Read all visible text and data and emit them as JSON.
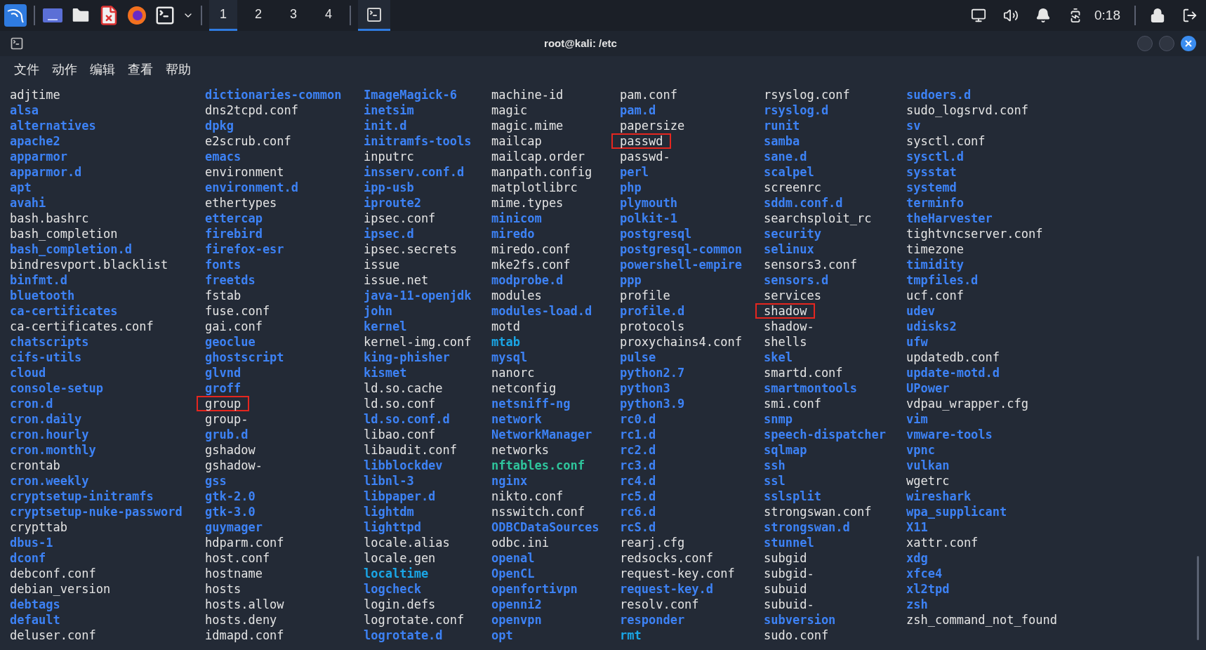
{
  "taskbar": {
    "workspaces": [
      {
        "label": "1",
        "selected": true
      },
      {
        "label": "2",
        "selected": false
      },
      {
        "label": "3",
        "selected": false
      },
      {
        "label": "4",
        "selected": false
      }
    ],
    "window_task": {
      "selected": true
    },
    "clock": "0:18"
  },
  "window": {
    "title": "root@kali: /etc"
  },
  "menu": [
    "文件",
    "动作",
    "编辑",
    "查看",
    "帮助"
  ],
  "listing": {
    "columns": [
      [
        {
          "name": "adjtime",
          "kind": "file",
          "highlighted": false
        },
        {
          "name": "alsa",
          "kind": "dir",
          "highlighted": false
        },
        {
          "name": "alternatives",
          "kind": "dir",
          "highlighted": false
        },
        {
          "name": "apache2",
          "kind": "dir",
          "highlighted": false
        },
        {
          "name": "apparmor",
          "kind": "dir",
          "highlighted": false
        },
        {
          "name": "apparmor.d",
          "kind": "dir",
          "highlighted": false
        },
        {
          "name": "apt",
          "kind": "dir",
          "highlighted": false
        },
        {
          "name": "avahi",
          "kind": "dir",
          "highlighted": false
        },
        {
          "name": "bash.bashrc",
          "kind": "file",
          "highlighted": false
        },
        {
          "name": "bash_completion",
          "kind": "file",
          "highlighted": false
        },
        {
          "name": "bash_completion.d",
          "kind": "dir",
          "highlighted": false
        },
        {
          "name": "bindresvport.blacklist",
          "kind": "file",
          "highlighted": false
        },
        {
          "name": "binfmt.d",
          "kind": "dir",
          "highlighted": false
        },
        {
          "name": "bluetooth",
          "kind": "dir",
          "highlighted": false
        },
        {
          "name": "ca-certificates",
          "kind": "dir",
          "highlighted": false
        },
        {
          "name": "ca-certificates.conf",
          "kind": "file",
          "highlighted": false
        },
        {
          "name": "chatscripts",
          "kind": "dir",
          "highlighted": false
        },
        {
          "name": "cifs-utils",
          "kind": "dir",
          "highlighted": false
        },
        {
          "name": "cloud",
          "kind": "dir",
          "highlighted": false
        },
        {
          "name": "console-setup",
          "kind": "dir",
          "highlighted": false
        },
        {
          "name": "cron.d",
          "kind": "dir",
          "highlighted": false
        },
        {
          "name": "cron.daily",
          "kind": "dir",
          "highlighted": false
        },
        {
          "name": "cron.hourly",
          "kind": "dir",
          "highlighted": false
        },
        {
          "name": "cron.monthly",
          "kind": "dir",
          "highlighted": false
        },
        {
          "name": "crontab",
          "kind": "file",
          "highlighted": false
        },
        {
          "name": "cron.weekly",
          "kind": "dir",
          "highlighted": false
        },
        {
          "name": "cryptsetup-initramfs",
          "kind": "dir",
          "highlighted": false
        },
        {
          "name": "cryptsetup-nuke-password",
          "kind": "dir",
          "highlighted": false
        },
        {
          "name": "crypttab",
          "kind": "file",
          "highlighted": false
        },
        {
          "name": "dbus-1",
          "kind": "dir",
          "highlighted": false
        },
        {
          "name": "dconf",
          "kind": "dir",
          "highlighted": false
        },
        {
          "name": "debconf.conf",
          "kind": "file",
          "highlighted": false
        },
        {
          "name": "debian_version",
          "kind": "file",
          "highlighted": false
        },
        {
          "name": "debtags",
          "kind": "dir",
          "highlighted": false
        },
        {
          "name": "default",
          "kind": "dir",
          "highlighted": false
        },
        {
          "name": "deluser.conf",
          "kind": "file",
          "highlighted": false
        }
      ],
      [
        {
          "name": "dictionaries-common",
          "kind": "dir",
          "highlighted": false
        },
        {
          "name": "dns2tcpd.conf",
          "kind": "file",
          "highlighted": false
        },
        {
          "name": "dpkg",
          "kind": "dir",
          "highlighted": false
        },
        {
          "name": "e2scrub.conf",
          "kind": "file",
          "highlighted": false
        },
        {
          "name": "emacs",
          "kind": "dir",
          "highlighted": false
        },
        {
          "name": "environment",
          "kind": "file",
          "highlighted": false
        },
        {
          "name": "environment.d",
          "kind": "dir",
          "highlighted": false
        },
        {
          "name": "ethertypes",
          "kind": "file",
          "highlighted": false
        },
        {
          "name": "ettercap",
          "kind": "dir",
          "highlighted": false
        },
        {
          "name": "firebird",
          "kind": "dir",
          "highlighted": false
        },
        {
          "name": "firefox-esr",
          "kind": "dir",
          "highlighted": false
        },
        {
          "name": "fonts",
          "kind": "dir",
          "highlighted": false
        },
        {
          "name": "freetds",
          "kind": "dir",
          "highlighted": false
        },
        {
          "name": "fstab",
          "kind": "file",
          "highlighted": false
        },
        {
          "name": "fuse.conf",
          "kind": "file",
          "highlighted": false
        },
        {
          "name": "gai.conf",
          "kind": "file",
          "highlighted": false
        },
        {
          "name": "geoclue",
          "kind": "dir",
          "highlighted": false
        },
        {
          "name": "ghostscript",
          "kind": "dir",
          "highlighted": false
        },
        {
          "name": "glvnd",
          "kind": "dir",
          "highlighted": false
        },
        {
          "name": "groff",
          "kind": "dir",
          "highlighted": false
        },
        {
          "name": "group",
          "kind": "file",
          "highlighted": true
        },
        {
          "name": "group-",
          "kind": "file",
          "highlighted": false
        },
        {
          "name": "grub.d",
          "kind": "dir",
          "highlighted": false
        },
        {
          "name": "gshadow",
          "kind": "file",
          "highlighted": false
        },
        {
          "name": "gshadow-",
          "kind": "file",
          "highlighted": false
        },
        {
          "name": "gss",
          "kind": "dir",
          "highlighted": false
        },
        {
          "name": "gtk-2.0",
          "kind": "dir",
          "highlighted": false
        },
        {
          "name": "gtk-3.0",
          "kind": "dir",
          "highlighted": false
        },
        {
          "name": "guymager",
          "kind": "dir",
          "highlighted": false
        },
        {
          "name": "hdparm.conf",
          "kind": "file",
          "highlighted": false
        },
        {
          "name": "host.conf",
          "kind": "file",
          "highlighted": false
        },
        {
          "name": "hostname",
          "kind": "file",
          "highlighted": false
        },
        {
          "name": "hosts",
          "kind": "file",
          "highlighted": false
        },
        {
          "name": "hosts.allow",
          "kind": "file",
          "highlighted": false
        },
        {
          "name": "hosts.deny",
          "kind": "file",
          "highlighted": false
        },
        {
          "name": "idmapd.conf",
          "kind": "file",
          "highlighted": false
        }
      ],
      [
        {
          "name": "ImageMagick-6",
          "kind": "dir",
          "highlighted": false
        },
        {
          "name": "inetsim",
          "kind": "dir",
          "highlighted": false
        },
        {
          "name": "init.d",
          "kind": "dir",
          "highlighted": false
        },
        {
          "name": "initramfs-tools",
          "kind": "dir",
          "highlighted": false
        },
        {
          "name": "inputrc",
          "kind": "file",
          "highlighted": false
        },
        {
          "name": "insserv.conf.d",
          "kind": "dir",
          "highlighted": false
        },
        {
          "name": "ipp-usb",
          "kind": "dir",
          "highlighted": false
        },
        {
          "name": "iproute2",
          "kind": "dir",
          "highlighted": false
        },
        {
          "name": "ipsec.conf",
          "kind": "file",
          "highlighted": false
        },
        {
          "name": "ipsec.d",
          "kind": "dir",
          "highlighted": false
        },
        {
          "name": "ipsec.secrets",
          "kind": "file",
          "highlighted": false
        },
        {
          "name": "issue",
          "kind": "file",
          "highlighted": false
        },
        {
          "name": "issue.net",
          "kind": "file",
          "highlighted": false
        },
        {
          "name": "java-11-openjdk",
          "kind": "dir",
          "highlighted": false
        },
        {
          "name": "john",
          "kind": "dir",
          "highlighted": false
        },
        {
          "name": "kernel",
          "kind": "dir",
          "highlighted": false
        },
        {
          "name": "kernel-img.conf",
          "kind": "file",
          "highlighted": false
        },
        {
          "name": "king-phisher",
          "kind": "dir",
          "highlighted": false
        },
        {
          "name": "kismet",
          "kind": "dir",
          "highlighted": false
        },
        {
          "name": "ld.so.cache",
          "kind": "file",
          "highlighted": false
        },
        {
          "name": "ld.so.conf",
          "kind": "file",
          "highlighted": false
        },
        {
          "name": "ld.so.conf.d",
          "kind": "dir",
          "highlighted": false
        },
        {
          "name": "libao.conf",
          "kind": "file",
          "highlighted": false
        },
        {
          "name": "libaudit.conf",
          "kind": "file",
          "highlighted": false
        },
        {
          "name": "libblockdev",
          "kind": "dir",
          "highlighted": false
        },
        {
          "name": "libnl-3",
          "kind": "dir",
          "highlighted": false
        },
        {
          "name": "libpaper.d",
          "kind": "dir",
          "highlighted": false
        },
        {
          "name": "lightdm",
          "kind": "dir",
          "highlighted": false
        },
        {
          "name": "lighttpd",
          "kind": "dir",
          "highlighted": false
        },
        {
          "name": "locale.alias",
          "kind": "file",
          "highlighted": false
        },
        {
          "name": "locale.gen",
          "kind": "file",
          "highlighted": false
        },
        {
          "name": "localtime",
          "kind": "link",
          "highlighted": false
        },
        {
          "name": "logcheck",
          "kind": "dir",
          "highlighted": false
        },
        {
          "name": "login.defs",
          "kind": "file",
          "highlighted": false
        },
        {
          "name": "logrotate.conf",
          "kind": "file",
          "highlighted": false
        },
        {
          "name": "logrotate.d",
          "kind": "dir",
          "highlighted": false
        }
      ],
      [
        {
          "name": "machine-id",
          "kind": "file",
          "highlighted": false
        },
        {
          "name": "magic",
          "kind": "file",
          "highlighted": false
        },
        {
          "name": "magic.mime",
          "kind": "file",
          "highlighted": false
        },
        {
          "name": "mailcap",
          "kind": "file",
          "highlighted": false
        },
        {
          "name": "mailcap.order",
          "kind": "file",
          "highlighted": false
        },
        {
          "name": "manpath.config",
          "kind": "file",
          "highlighted": false
        },
        {
          "name": "matplotlibrc",
          "kind": "file",
          "highlighted": false
        },
        {
          "name": "mime.types",
          "kind": "file",
          "highlighted": false
        },
        {
          "name": "minicom",
          "kind": "dir",
          "highlighted": false
        },
        {
          "name": "miredo",
          "kind": "dir",
          "highlighted": false
        },
        {
          "name": "miredo.conf",
          "kind": "file",
          "highlighted": false
        },
        {
          "name": "mke2fs.conf",
          "kind": "file",
          "highlighted": false
        },
        {
          "name": "modprobe.d",
          "kind": "dir",
          "highlighted": false
        },
        {
          "name": "modules",
          "kind": "file",
          "highlighted": false
        },
        {
          "name": "modules-load.d",
          "kind": "dir",
          "highlighted": false
        },
        {
          "name": "motd",
          "kind": "file",
          "highlighted": false
        },
        {
          "name": "mtab",
          "kind": "link",
          "highlighted": false
        },
        {
          "name": "mysql",
          "kind": "dir",
          "highlighted": false
        },
        {
          "name": "nanorc",
          "kind": "file",
          "highlighted": false
        },
        {
          "name": "netconfig",
          "kind": "file",
          "highlighted": false
        },
        {
          "name": "netsniff-ng",
          "kind": "dir",
          "highlighted": false
        },
        {
          "name": "network",
          "kind": "dir",
          "highlighted": false
        },
        {
          "name": "NetworkManager",
          "kind": "dir",
          "highlighted": false
        },
        {
          "name": "networks",
          "kind": "file",
          "highlighted": false
        },
        {
          "name": "nftables.conf",
          "kind": "exec",
          "highlighted": false
        },
        {
          "name": "nginx",
          "kind": "dir",
          "highlighted": false
        },
        {
          "name": "nikto.conf",
          "kind": "file",
          "highlighted": false
        },
        {
          "name": "nsswitch.conf",
          "kind": "file",
          "highlighted": false
        },
        {
          "name": "ODBCDataSources",
          "kind": "dir",
          "highlighted": false
        },
        {
          "name": "odbc.ini",
          "kind": "file",
          "highlighted": false
        },
        {
          "name": "openal",
          "kind": "dir",
          "highlighted": false
        },
        {
          "name": "OpenCL",
          "kind": "dir",
          "highlighted": false
        },
        {
          "name": "openfortivpn",
          "kind": "dir",
          "highlighted": false
        },
        {
          "name": "openni2",
          "kind": "dir",
          "highlighted": false
        },
        {
          "name": "openvpn",
          "kind": "dir",
          "highlighted": false
        },
        {
          "name": "opt",
          "kind": "dir",
          "highlighted": false
        }
      ],
      [
        {
          "name": "pam.conf",
          "kind": "file",
          "highlighted": false
        },
        {
          "name": "pam.d",
          "kind": "dir",
          "highlighted": false
        },
        {
          "name": "papersize",
          "kind": "file",
          "highlighted": false
        },
        {
          "name": "passwd",
          "kind": "file",
          "highlighted": true
        },
        {
          "name": "passwd-",
          "kind": "file",
          "highlighted": false
        },
        {
          "name": "perl",
          "kind": "dir",
          "highlighted": false
        },
        {
          "name": "php",
          "kind": "dir",
          "highlighted": false
        },
        {
          "name": "plymouth",
          "kind": "dir",
          "highlighted": false
        },
        {
          "name": "polkit-1",
          "kind": "dir",
          "highlighted": false
        },
        {
          "name": "postgresql",
          "kind": "dir",
          "highlighted": false
        },
        {
          "name": "postgresql-common",
          "kind": "dir",
          "highlighted": false
        },
        {
          "name": "powershell-empire",
          "kind": "dir",
          "highlighted": false
        },
        {
          "name": "ppp",
          "kind": "dir",
          "highlighted": false
        },
        {
          "name": "profile",
          "kind": "file",
          "highlighted": false
        },
        {
          "name": "profile.d",
          "kind": "dir",
          "highlighted": false
        },
        {
          "name": "protocols",
          "kind": "file",
          "highlighted": false
        },
        {
          "name": "proxychains4.conf",
          "kind": "file",
          "highlighted": false
        },
        {
          "name": "pulse",
          "kind": "dir",
          "highlighted": false
        },
        {
          "name": "python2.7",
          "kind": "dir",
          "highlighted": false
        },
        {
          "name": "python3",
          "kind": "dir",
          "highlighted": false
        },
        {
          "name": "python3.9",
          "kind": "dir",
          "highlighted": false
        },
        {
          "name": "rc0.d",
          "kind": "dir",
          "highlighted": false
        },
        {
          "name": "rc1.d",
          "kind": "dir",
          "highlighted": false
        },
        {
          "name": "rc2.d",
          "kind": "dir",
          "highlighted": false
        },
        {
          "name": "rc3.d",
          "kind": "dir",
          "highlighted": false
        },
        {
          "name": "rc4.d",
          "kind": "dir",
          "highlighted": false
        },
        {
          "name": "rc5.d",
          "kind": "dir",
          "highlighted": false
        },
        {
          "name": "rc6.d",
          "kind": "dir",
          "highlighted": false
        },
        {
          "name": "rcS.d",
          "kind": "dir",
          "highlighted": false
        },
        {
          "name": "rearj.cfg",
          "kind": "file",
          "highlighted": false
        },
        {
          "name": "redsocks.conf",
          "kind": "file",
          "highlighted": false
        },
        {
          "name": "request-key.conf",
          "kind": "file",
          "highlighted": false
        },
        {
          "name": "request-key.d",
          "kind": "dir",
          "highlighted": false
        },
        {
          "name": "resolv.conf",
          "kind": "file",
          "highlighted": false
        },
        {
          "name": "responder",
          "kind": "dir",
          "highlighted": false
        },
        {
          "name": "rmt",
          "kind": "link",
          "highlighted": false
        }
      ],
      [
        {
          "name": "rsyslog.conf",
          "kind": "file",
          "highlighted": false
        },
        {
          "name": "rsyslog.d",
          "kind": "dir",
          "highlighted": false
        },
        {
          "name": "runit",
          "kind": "dir",
          "highlighted": false
        },
        {
          "name": "samba",
          "kind": "dir",
          "highlighted": false
        },
        {
          "name": "sane.d",
          "kind": "dir",
          "highlighted": false
        },
        {
          "name": "scalpel",
          "kind": "dir",
          "highlighted": false
        },
        {
          "name": "screenrc",
          "kind": "file",
          "highlighted": false
        },
        {
          "name": "sddm.conf.d",
          "kind": "dir",
          "highlighted": false
        },
        {
          "name": "searchsploit_rc",
          "kind": "file",
          "highlighted": false
        },
        {
          "name": "security",
          "kind": "dir",
          "highlighted": false
        },
        {
          "name": "selinux",
          "kind": "dir",
          "highlighted": false
        },
        {
          "name": "sensors3.conf",
          "kind": "file",
          "highlighted": false
        },
        {
          "name": "sensors.d",
          "kind": "dir",
          "highlighted": false
        },
        {
          "name": "services",
          "kind": "file",
          "highlighted": false
        },
        {
          "name": "shadow",
          "kind": "file",
          "highlighted": true
        },
        {
          "name": "shadow-",
          "kind": "file",
          "highlighted": false
        },
        {
          "name": "shells",
          "kind": "file",
          "highlighted": false
        },
        {
          "name": "skel",
          "kind": "dir",
          "highlighted": false
        },
        {
          "name": "smartd.conf",
          "kind": "file",
          "highlighted": false
        },
        {
          "name": "smartmontools",
          "kind": "dir",
          "highlighted": false
        },
        {
          "name": "smi.conf",
          "kind": "file",
          "highlighted": false
        },
        {
          "name": "snmp",
          "kind": "dir",
          "highlighted": false
        },
        {
          "name": "speech-dispatcher",
          "kind": "dir",
          "highlighted": false
        },
        {
          "name": "sqlmap",
          "kind": "dir",
          "highlighted": false
        },
        {
          "name": "ssh",
          "kind": "dir",
          "highlighted": false
        },
        {
          "name": "ssl",
          "kind": "dir",
          "highlighted": false
        },
        {
          "name": "sslsplit",
          "kind": "dir",
          "highlighted": false
        },
        {
          "name": "strongswan.conf",
          "kind": "file",
          "highlighted": false
        },
        {
          "name": "strongswan.d",
          "kind": "dir",
          "highlighted": false
        },
        {
          "name": "stunnel",
          "kind": "dir",
          "highlighted": false
        },
        {
          "name": "subgid",
          "kind": "file",
          "highlighted": false
        },
        {
          "name": "subgid-",
          "kind": "file",
          "highlighted": false
        },
        {
          "name": "subuid",
          "kind": "file",
          "highlighted": false
        },
        {
          "name": "subuid-",
          "kind": "file",
          "highlighted": false
        },
        {
          "name": "subversion",
          "kind": "dir",
          "highlighted": false
        },
        {
          "name": "sudo.conf",
          "kind": "file",
          "highlighted": false
        }
      ],
      [
        {
          "name": "sudoers.d",
          "kind": "dir",
          "highlighted": false
        },
        {
          "name": "sudo_logsrvd.conf",
          "kind": "file",
          "highlighted": false
        },
        {
          "name": "sv",
          "kind": "dir",
          "highlighted": false
        },
        {
          "name": "sysctl.conf",
          "kind": "file",
          "highlighted": false
        },
        {
          "name": "sysctl.d",
          "kind": "dir",
          "highlighted": false
        },
        {
          "name": "sysstat",
          "kind": "dir",
          "highlighted": false
        },
        {
          "name": "systemd",
          "kind": "dir",
          "highlighted": false
        },
        {
          "name": "terminfo",
          "kind": "dir",
          "highlighted": false
        },
        {
          "name": "theHarvester",
          "kind": "dir",
          "highlighted": false
        },
        {
          "name": "tightvncserver.conf",
          "kind": "file",
          "highlighted": false
        },
        {
          "name": "timezone",
          "kind": "file",
          "highlighted": false
        },
        {
          "name": "timidity",
          "kind": "dir",
          "highlighted": false
        },
        {
          "name": "tmpfiles.d",
          "kind": "dir",
          "highlighted": false
        },
        {
          "name": "ucf.conf",
          "kind": "file",
          "highlighted": false
        },
        {
          "name": "udev",
          "kind": "dir",
          "highlighted": false
        },
        {
          "name": "udisks2",
          "kind": "dir",
          "highlighted": false
        },
        {
          "name": "ufw",
          "kind": "dir",
          "highlighted": false
        },
        {
          "name": "updatedb.conf",
          "kind": "file",
          "highlighted": false
        },
        {
          "name": "update-motd.d",
          "kind": "dir",
          "highlighted": false
        },
        {
          "name": "UPower",
          "kind": "dir",
          "highlighted": false
        },
        {
          "name": "vdpau_wrapper.cfg",
          "kind": "file",
          "highlighted": false
        },
        {
          "name": "vim",
          "kind": "dir",
          "highlighted": false
        },
        {
          "name": "vmware-tools",
          "kind": "dir",
          "highlighted": false
        },
        {
          "name": "vpnc",
          "kind": "dir",
          "highlighted": false
        },
        {
          "name": "vulkan",
          "kind": "dir",
          "highlighted": false
        },
        {
          "name": "wgetrc",
          "kind": "file",
          "highlighted": false
        },
        {
          "name": "wireshark",
          "kind": "dir",
          "highlighted": false
        },
        {
          "name": "wpa_supplicant",
          "kind": "dir",
          "highlighted": false
        },
        {
          "name": "X11",
          "kind": "dir",
          "highlighted": false
        },
        {
          "name": "xattr.conf",
          "kind": "file",
          "highlighted": false
        },
        {
          "name": "xdg",
          "kind": "dir",
          "highlighted": false
        },
        {
          "name": "xfce4",
          "kind": "dir",
          "highlighted": false
        },
        {
          "name": "xl2tpd",
          "kind": "dir",
          "highlighted": false
        },
        {
          "name": "zsh",
          "kind": "dir",
          "highlighted": false
        },
        {
          "name": "zsh_command_not_found",
          "kind": "file",
          "highlighted": false
        }
      ]
    ]
  }
}
